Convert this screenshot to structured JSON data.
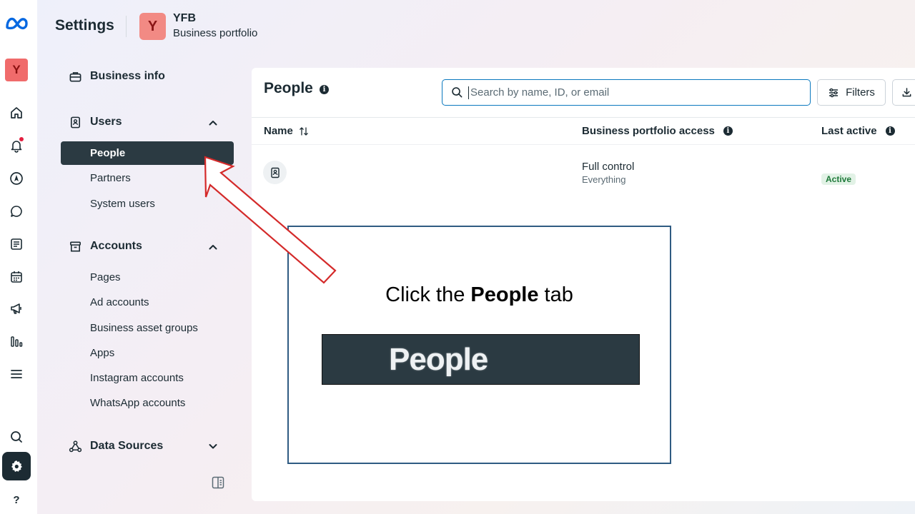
{
  "header": {
    "title": "Settings",
    "business_initial": "Y",
    "business_name": "YFB",
    "business_subtitle": "Business portfolio"
  },
  "rail": {
    "avatar_initial": "Y",
    "help_label": "?",
    "icons": [
      "meta-logo-icon",
      "home-icon",
      "bell-icon",
      "compass-icon",
      "chat-icon",
      "content-icon",
      "calendar-icon",
      "megaphone-icon",
      "chart-icon",
      "menu-icon",
      "search-icon",
      "gear-icon",
      "help-icon"
    ]
  },
  "sidebar": {
    "business_info": "Business info",
    "users": {
      "label": "Users",
      "items": [
        "People",
        "Partners",
        "System users"
      ]
    },
    "accounts": {
      "label": "Accounts",
      "items": [
        "Pages",
        "Ad accounts",
        "Business asset groups",
        "Apps",
        "Instagram accounts",
        "WhatsApp accounts"
      ]
    },
    "data_sources": "Data Sources"
  },
  "main": {
    "title": "People",
    "search_placeholder": "Search by name, ID, or email",
    "filters_label": "Filters",
    "columns": [
      "Name",
      "Business portfolio access",
      "Last active"
    ],
    "rows": [
      {
        "access": "Full control",
        "access_detail": "Everything",
        "status": "Active"
      }
    ]
  },
  "callout": {
    "prefix": "Click the ",
    "emphasis": "People",
    "suffix": " tab",
    "preview_label": "People"
  },
  "colors": {
    "accent": "#0a78be",
    "active_nav": "#2b3a42",
    "arrow": "#d42a2a",
    "callout_border": "#2f5b82",
    "badge_bg": "#e2f2e6"
  }
}
